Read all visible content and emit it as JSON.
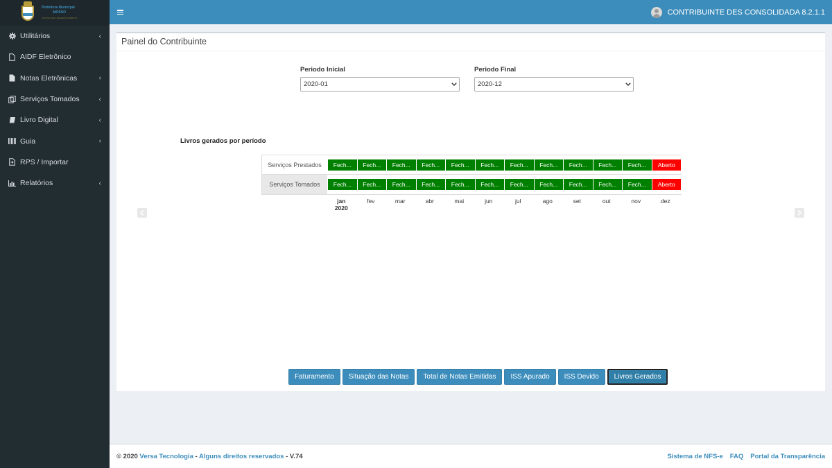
{
  "logo": {
    "line1": "Prefeitura Municipal",
    "line2": "MOSSO",
    "line3": "JUNTOS PELO DESENVOLVIMENTO"
  },
  "sidebar": {
    "items": [
      {
        "label": "Utilitários",
        "icon": "gear-icon",
        "caret": "‹"
      },
      {
        "label": "AIDF Eletrônico",
        "icon": "file-icon",
        "caret": ""
      },
      {
        "label": "Notas Eletrônicas",
        "icon": "file-text-icon",
        "caret": "‹"
      },
      {
        "label": "Serviços Tomados",
        "icon": "copy-icon",
        "caret": "‹"
      },
      {
        "label": "Livro Digital",
        "icon": "book-icon",
        "caret": "‹"
      },
      {
        "label": "Guia",
        "icon": "barcode-icon",
        "caret": "‹"
      },
      {
        "label": "RPS / Importar",
        "icon": "import-file-icon",
        "caret": ""
      },
      {
        "label": "Relatórios",
        "icon": "bar-chart-icon",
        "caret": "‹"
      }
    ]
  },
  "header": {
    "user_name": "CONTRIBUINTE DES CONSOLIDADA 8.2.1.1"
  },
  "panel": {
    "title": "Painel do Contribuinte"
  },
  "filters": {
    "start_label": "Periodo Inicial",
    "start_value": "2020-01",
    "end_label": "Periodo Final",
    "end_value": "2020-12"
  },
  "timeline": {
    "title": "Livros gerados por período",
    "rows": [
      {
        "label": "Serviços Prestados",
        "cells": [
          "Fech...",
          "Fech...",
          "Fech...",
          "Fech...",
          "Fech...",
          "Fech...",
          "Fech...",
          "Fech...",
          "Fech...",
          "Fech...",
          "Fech...",
          "Aberto"
        ]
      },
      {
        "label": "Serviços Tomados",
        "cells": [
          "Fech...",
          "Fech...",
          "Fech...",
          "Fech...",
          "Fech...",
          "Fech...",
          "Fech...",
          "Fech...",
          "Fech...",
          "Fech...",
          "Fech...",
          "Aberto"
        ]
      }
    ],
    "months": [
      "jan",
      "fev",
      "mar",
      "abr",
      "mai",
      "jun",
      "jul",
      "ago",
      "set",
      "out",
      "nov",
      "dez"
    ],
    "year": "2020",
    "colors": {
      "closed": "#008000",
      "open": "#ff0000"
    }
  },
  "tabs": {
    "buttons": [
      "Faturamento",
      "Situação das Notas",
      "Total de Notas Emitidas",
      "ISS Apurado",
      "ISS Devido",
      "Livros Gerados"
    ],
    "active": "Livros Gerados"
  },
  "footer": {
    "copyright": "© 2020",
    "company": "Versa Tecnologia",
    "separator": "-",
    "rights": "Alguns direitos reservados",
    "version": "-  V.74",
    "links": [
      "Sistema de NFS-e",
      "FAQ",
      "Portal da Transparência"
    ]
  },
  "colors": {
    "primary": "#3c8dbc",
    "sidebar_bg": "#222d32"
  }
}
